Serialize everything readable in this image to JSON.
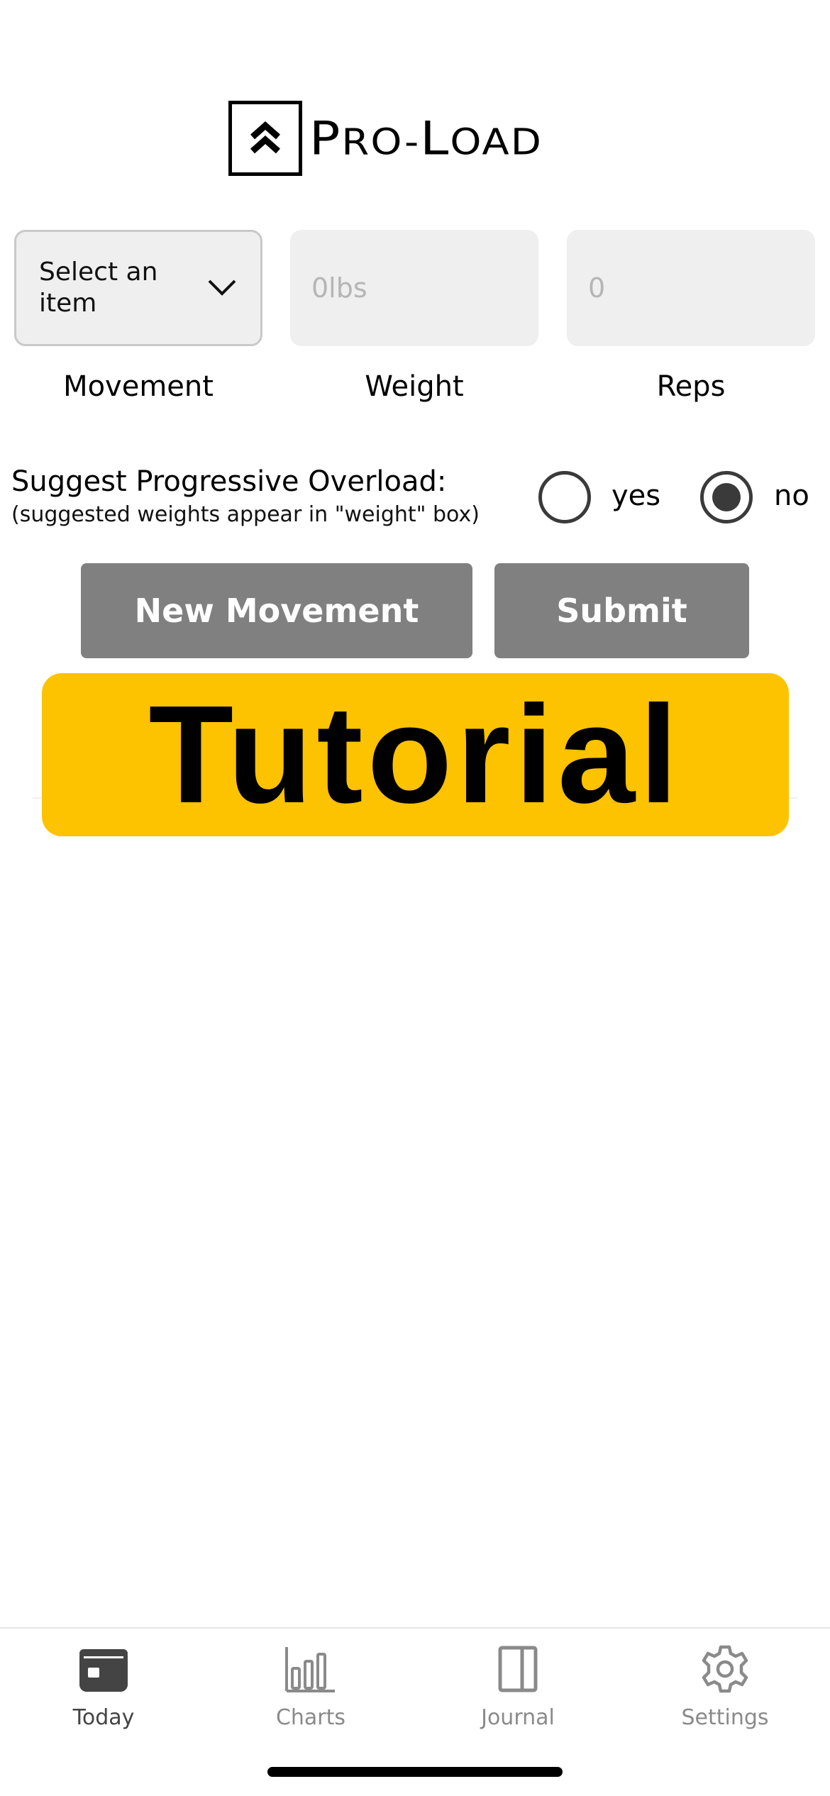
{
  "logo": {
    "text_main": "PRO-LOAD",
    "text_first": "P",
    "text_ro": "RO-",
    "text_l": "L",
    "text_oad": "OAD"
  },
  "inputs": {
    "movement": {
      "value": "Select an item",
      "label": "Movement"
    },
    "weight": {
      "placeholder": "0lbs",
      "label": "Weight"
    },
    "reps": {
      "placeholder": "0",
      "label": "Reps"
    }
  },
  "overload": {
    "title": "Suggest Progressive Overload:",
    "subtitle": "(suggested weights appear in \"weight\" box)",
    "options": [
      {
        "label": "yes",
        "selected": false
      },
      {
        "label": "no",
        "selected": true
      }
    ]
  },
  "buttons": {
    "new_movement": "New Movement",
    "submit": "Submit"
  },
  "tutorial": {
    "label": "Tutorial",
    "color": "#fdc200"
  },
  "tabbar": {
    "tabs": [
      {
        "label": "Today",
        "icon": "calendar-icon",
        "active": true
      },
      {
        "label": "Charts",
        "icon": "bar-chart-icon",
        "active": false
      },
      {
        "label": "Journal",
        "icon": "journal-icon",
        "active": false
      },
      {
        "label": "Settings",
        "icon": "gear-icon",
        "active": false
      }
    ]
  },
  "colors": {
    "button_gray": "#808080",
    "radio_dark": "#3a3a3a",
    "field_bg": "#efefef"
  }
}
